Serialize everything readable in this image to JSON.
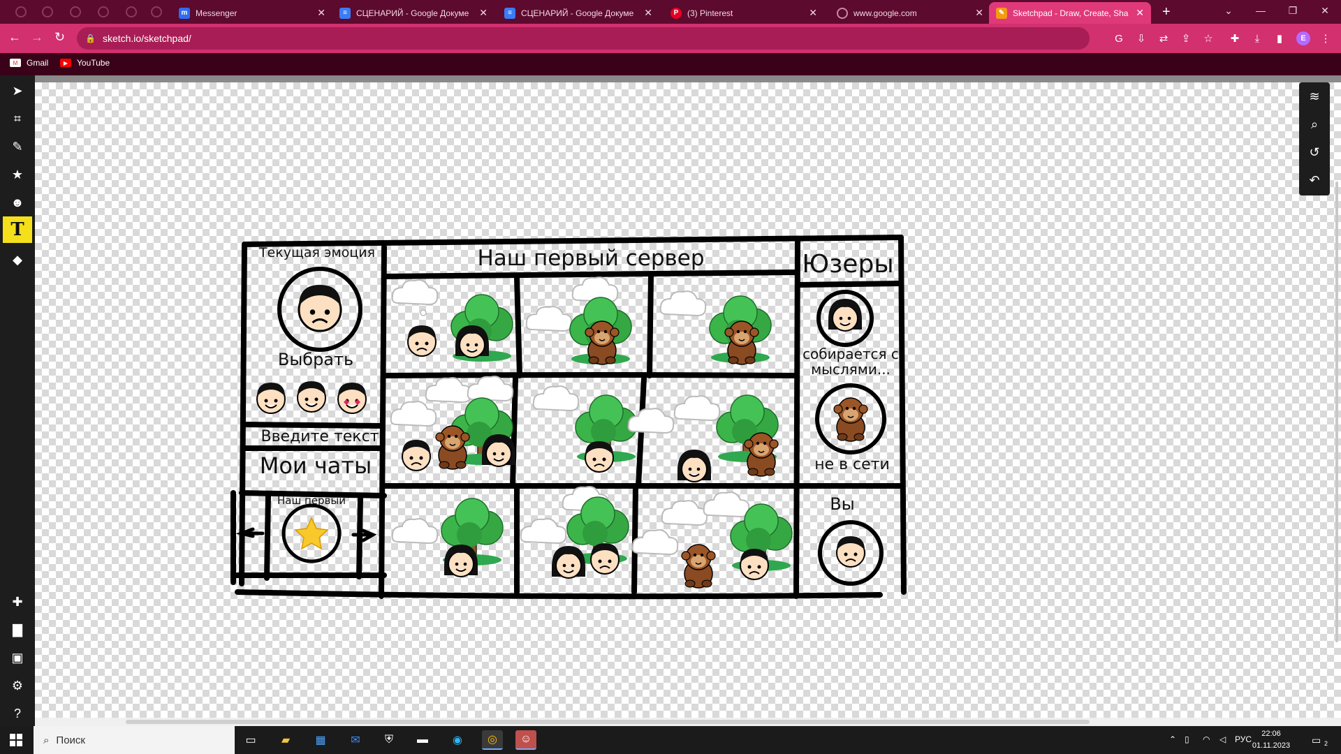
{
  "browser": {
    "tabs": [
      {
        "label": "",
        "icon": "blank-tab-icon"
      },
      {
        "label": "Messenger",
        "icon": "messenger-icon"
      },
      {
        "label": "СЦЕНАРИЙ - Google Докуме",
        "icon": "google-docs-icon"
      },
      {
        "label": "СЦЕНАРИЙ - Google Докуме",
        "icon": "google-docs-icon"
      },
      {
        "label": "(3) Pinterest",
        "icon": "pinterest-icon"
      },
      {
        "label": "www.google.com",
        "icon": "globe-icon"
      },
      {
        "label": "Sketchpad - Draw, Create, Sha",
        "icon": "sketchpad-icon",
        "active": true
      }
    ],
    "address": "sketch.io/sketchpad/",
    "profile_initial": "E",
    "bookmarks": [
      {
        "label": "Gmail",
        "icon": "gmail-icon"
      },
      {
        "label": "YouTube",
        "icon": "youtube-icon"
      }
    ],
    "accent_color": "#d2306f"
  },
  "sketchpad": {
    "left_tools": [
      "select-tool-icon",
      "crop-tool-icon",
      "pencil-tool-icon",
      "star-stamp-icon",
      "emoji-stamp-icon",
      "text-tool-icon",
      "fill-bucket-icon"
    ],
    "left_tools_bottom": [
      "add-icon",
      "folder-icon",
      "save-icon",
      "settings-icon",
      "help-icon"
    ],
    "right_tools": [
      "layers-icon",
      "zoom-icon",
      "history-icon",
      "undo-icon"
    ],
    "active_tool": "text-tool-icon"
  },
  "drawing": {
    "current_emotion_label": "Текущая эмоция",
    "choose_label": "Выбрать",
    "input_placeholder": "Введите текст",
    "my_chats_label": "Мои чаты",
    "chat_name": "Наш первый",
    "server_title": "Наш первый сервер",
    "users_title": "Юзеры",
    "user1_status": "собирается с мыслями...",
    "user1_status_line1": "собирается с",
    "user1_status_line2": "мыслями...",
    "user2_status": "не в сети",
    "you_label": "Вы"
  },
  "taskbar": {
    "search_placeholder": "Поиск",
    "language": "РУС",
    "time": "22:06",
    "date": "01.11.2023",
    "notifications": "2",
    "apps": [
      "task-view-icon",
      "file-explorer-icon",
      "store-icon",
      "mail-icon",
      "security-icon",
      "terminal-icon",
      "edge-icon",
      "chrome-icon",
      "discord-icon"
    ]
  }
}
